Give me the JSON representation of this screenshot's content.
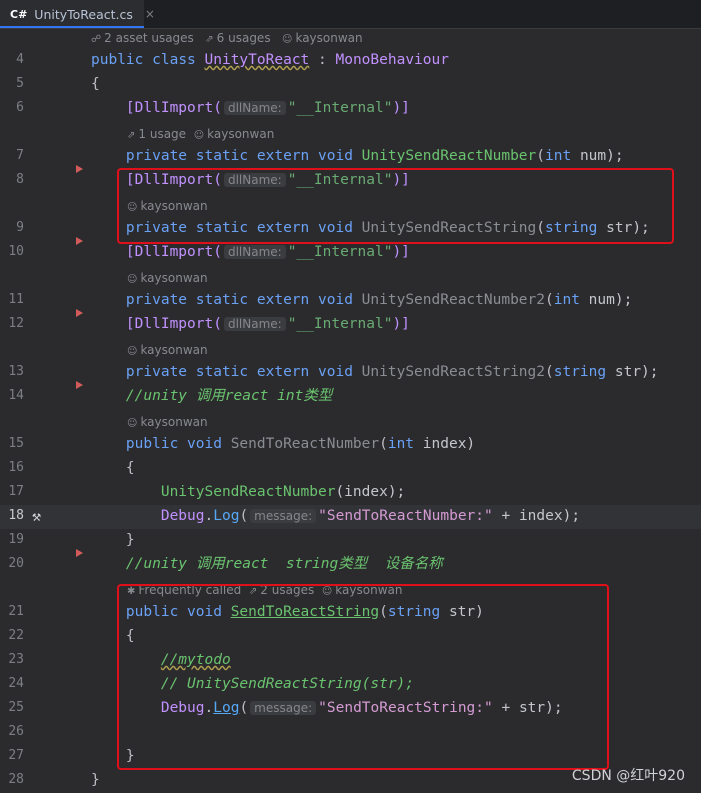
{
  "tab": {
    "lang_badge": "C#",
    "file_name": "UnityToReact.cs",
    "close": "×"
  },
  "line_numbers": [
    "4",
    "5",
    "6",
    "7",
    "8",
    "9",
    "10",
    "11",
    "12",
    "13",
    "14",
    "15",
    "16",
    "17",
    "18",
    "19",
    "20",
    "21",
    "22",
    "23",
    "24",
    "25",
    "26",
    "27",
    "28"
  ],
  "hints": {
    "class_usages": "2 asset usages",
    "class_usages2": "6 usages",
    "class_author": "kaysonwan",
    "m7_usages": "1 usage",
    "m7_author": "kaysonwan",
    "m9_author": "kaysonwan",
    "m11_author": "kaysonwan",
    "m13_author": "kaysonwan",
    "m15_author": "kaysonwan",
    "m21_freq": "Frequently called",
    "m21_usages": "2 usages",
    "m21_author": "kaysonwan"
  },
  "code": {
    "public": "public",
    "class": "class",
    "class_name": "UnityToReact",
    "colon": " : ",
    "base_class": "MonoBehaviour",
    "open_brace": "{",
    "close_brace": "}",
    "dllimport": "[DllImport(",
    "dllname_hint": "dllName:",
    "internal_str": "\"__Internal\"",
    "dll_close": ")]",
    "private": "private",
    "static": "static",
    "extern": "extern",
    "void": "void",
    "int": "int",
    "string": "string",
    "fn_send_number": "UnitySendReactNumber",
    "fn_send_string": "UnitySendReactString",
    "fn_send_number2": "UnitySendReactNumber2",
    "fn_send_string2": "UnitySendReactString2",
    "param_num": " num);",
    "param_str": " str);",
    "comment_14": "//unity 调用react int类型",
    "fn_to_react_number": "SendToReactNumber",
    "param_index_decl": " index)",
    "call_number_arg": "(index);",
    "debug": "Debug",
    "log": "Log",
    "message_hint": "message:",
    "log_number_str": "\"SendToReactNumber:\"",
    "log_number_tail": " + index);",
    "comment_20": "//unity 调用react  string类型  设备名称",
    "fn_to_react_string": "SendToReactString",
    "param_str_decl": " str)",
    "comment_23": "//mytodo",
    "comment_24": "// UnitySendReactString(str);",
    "log_string_str": "\"SendToReactString:\"",
    "log_string_tail": " + str);",
    "dot": ".",
    "open_paren": "("
  },
  "watermark": "CSDN @红叶920",
  "colors": {
    "highlight_box": "#e0101a",
    "background": "#2b2b2d"
  }
}
